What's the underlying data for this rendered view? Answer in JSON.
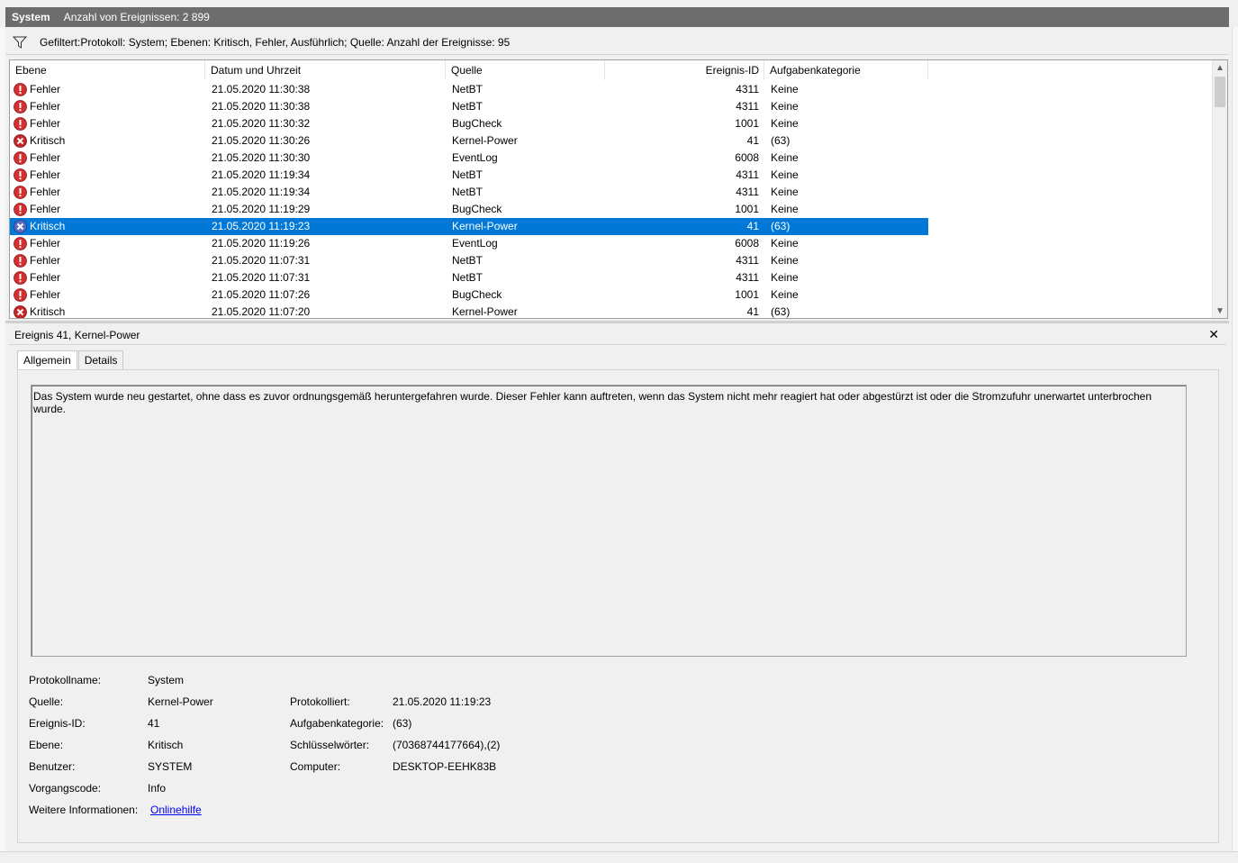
{
  "titlebar": {
    "name": "System",
    "count": "Anzahl von Ereignissen: 2 899"
  },
  "filter": {
    "text": "Gefiltert:Protokoll: System; Ebenen: Kritisch, Fehler, Ausführlich; Quelle:  Anzahl der Ereignisse: 95"
  },
  "columns": {
    "level": "Ebene",
    "date": "Datum und Uhrzeit",
    "source": "Quelle",
    "id": "Ereignis-ID",
    "category": "Aufgabenkategorie"
  },
  "events": [
    {
      "level": "Fehler",
      "icon": "error-icon",
      "date": "21.05.2020 11:30:38",
      "source": "NetBT",
      "id": "4311",
      "category": "Keine"
    },
    {
      "level": "Fehler",
      "icon": "error-icon",
      "date": "21.05.2020 11:30:38",
      "source": "NetBT",
      "id": "4311",
      "category": "Keine"
    },
    {
      "level": "Fehler",
      "icon": "error-icon",
      "date": "21.05.2020 11:30:32",
      "source": "BugCheck",
      "id": "1001",
      "category": "Keine"
    },
    {
      "level": "Kritisch",
      "icon": "critical-icon",
      "date": "21.05.2020 11:30:26",
      "source": "Kernel-Power",
      "id": "41",
      "category": "(63)"
    },
    {
      "level": "Fehler",
      "icon": "error-icon",
      "date": "21.05.2020 11:30:30",
      "source": "EventLog",
      "id": "6008",
      "category": "Keine"
    },
    {
      "level": "Fehler",
      "icon": "error-icon",
      "date": "21.05.2020 11:19:34",
      "source": "NetBT",
      "id": "4311",
      "category": "Keine"
    },
    {
      "level": "Fehler",
      "icon": "error-icon",
      "date": "21.05.2020 11:19:34",
      "source": "NetBT",
      "id": "4311",
      "category": "Keine"
    },
    {
      "level": "Fehler",
      "icon": "error-icon",
      "date": "21.05.2020 11:19:29",
      "source": "BugCheck",
      "id": "1001",
      "category": "Keine"
    },
    {
      "level": "Kritisch",
      "icon": "critical-icon",
      "date": "21.05.2020 11:19:23",
      "source": "Kernel-Power",
      "id": "41",
      "category": "(63)",
      "selected": true
    },
    {
      "level": "Fehler",
      "icon": "error-icon",
      "date": "21.05.2020 11:19:26",
      "source": "EventLog",
      "id": "6008",
      "category": "Keine"
    },
    {
      "level": "Fehler",
      "icon": "error-icon",
      "date": "21.05.2020 11:07:31",
      "source": "NetBT",
      "id": "4311",
      "category": "Keine"
    },
    {
      "level": "Fehler",
      "icon": "error-icon",
      "date": "21.05.2020 11:07:31",
      "source": "NetBT",
      "id": "4311",
      "category": "Keine"
    },
    {
      "level": "Fehler",
      "icon": "error-icon",
      "date": "21.05.2020 11:07:26",
      "source": "BugCheck",
      "id": "1001",
      "category": "Keine"
    },
    {
      "level": "Kritisch",
      "icon": "critical-icon",
      "date": "21.05.2020 11:07:20",
      "source": "Kernel-Power",
      "id": "41",
      "category": "(63)"
    }
  ],
  "detail": {
    "title": "Ereignis 41, Kernel-Power",
    "close": "✕",
    "tabs": {
      "general": "Allgemein",
      "details": "Details"
    },
    "description": "Das System wurde neu gestartet, ohne dass es zuvor ordnungsgemäß heruntergefahren wurde. Dieser Fehler kann auftreten, wenn das System nicht mehr reagiert hat oder abgestürzt ist oder die Stromzufuhr unerwartet unterbrochen wurde.",
    "props": {
      "logname_label": "Protokollname:",
      "logname": "System",
      "source_label": "Quelle:",
      "source": "Kernel-Power",
      "logged_label": "Protokolliert:",
      "logged": "21.05.2020 11:19:23",
      "id_label": "Ereignis-ID:",
      "id": "41",
      "category_label": "Aufgabenkategorie:",
      "category": "(63)",
      "level_label": "Ebene:",
      "level": "Kritisch",
      "keywords_label": "Schlüsselwörter:",
      "keywords": "(70368744177664),(2)",
      "user_label": "Benutzer:",
      "user": "SYSTEM",
      "computer_label": "Computer:",
      "computer": "DESKTOP-EEHK83B",
      "opcode_label": "Vorgangscode:",
      "opcode": "Info",
      "moreinfo_label": "Weitere Informationen:",
      "moreinfo": "Onlinehilfe"
    }
  }
}
